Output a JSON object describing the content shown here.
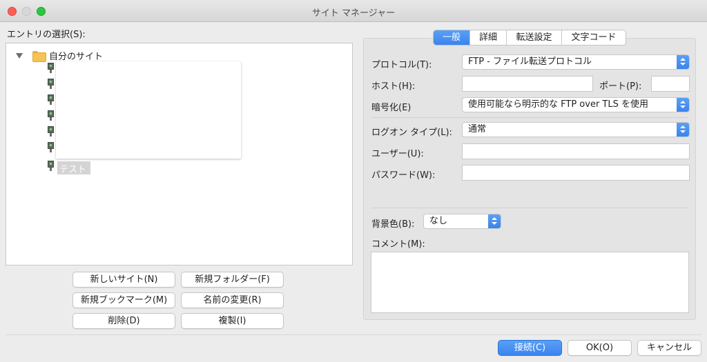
{
  "window": {
    "title": "サイト マネージャー"
  },
  "left": {
    "entry_label": "エントリの選択(S):",
    "tree": {
      "root_label": "自分のサイト",
      "sites": [
        "",
        "",
        "",
        "",
        "",
        "",
        "テスト"
      ]
    },
    "buttons": {
      "new_site": "新しいサイト(N)",
      "new_folder": "新規フォルダー(F)",
      "new_bookmark": "新規ブックマーク(M)",
      "rename": "名前の変更(R)",
      "delete": "削除(D)",
      "duplicate": "複製(I)"
    }
  },
  "tabs": [
    {
      "label": "一般",
      "active": true
    },
    {
      "label": "詳細",
      "active": false
    },
    {
      "label": "転送設定",
      "active": false
    },
    {
      "label": "文字コード",
      "active": false
    }
  ],
  "general": {
    "protocol_label": "プロトコル(T):",
    "protocol_value": "FTP - ファイル転送プロトコル",
    "host_label": "ホスト(H):",
    "host_value": "",
    "port_label": "ポート(P):",
    "port_value": "",
    "encryption_label": "暗号化(E)",
    "encryption_value": "使用可能なら明示的な FTP over TLS を使用",
    "logon_label": "ログオン タイプ(L):",
    "logon_value": "通常",
    "user_label": "ユーザー(U):",
    "user_value": "",
    "password_label": "パスワード(W):",
    "password_value": "",
    "bgcolor_label": "背景色(B):",
    "bgcolor_value": "なし",
    "comment_label": "コメント(M):",
    "comment_value": ""
  },
  "footer": {
    "connect": "接続(C)",
    "ok": "OK(O)",
    "cancel": "キャンセル"
  },
  "colors": {
    "accent": "#3a84ee",
    "folder": "#f6c453"
  }
}
